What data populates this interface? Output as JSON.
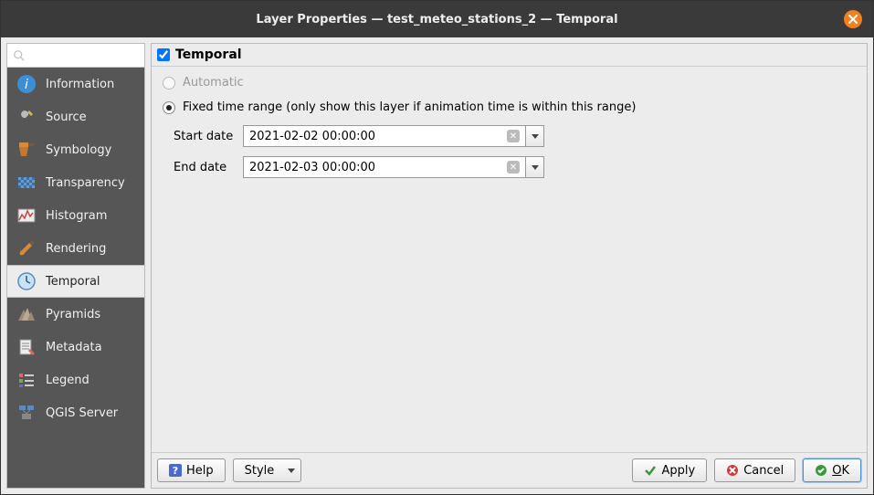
{
  "title": "Layer Properties — test_meteo_stations_2 — Temporal",
  "sidebar": {
    "items": [
      {
        "label": "Information"
      },
      {
        "label": "Source"
      },
      {
        "label": "Symbology"
      },
      {
        "label": "Transparency"
      },
      {
        "label": "Histogram"
      },
      {
        "label": "Rendering"
      },
      {
        "label": "Temporal"
      },
      {
        "label": "Pyramids"
      },
      {
        "label": "Metadata"
      },
      {
        "label": "Legend"
      },
      {
        "label": "QGIS Server"
      }
    ],
    "selected": "Temporal"
  },
  "section": {
    "checked": true,
    "title": "Temporal"
  },
  "options": {
    "automatic": {
      "label": "Automatic",
      "selected": false,
      "enabled": false
    },
    "fixed": {
      "label": "Fixed time range (only show this layer if animation time is within this range)",
      "selected": true
    }
  },
  "dates": {
    "start_label": "Start date",
    "start_value": "2021-02-02 00:00:00",
    "end_label": "End date",
    "end_value": "2021-02-03 00:00:00"
  },
  "footer": {
    "help": "Help",
    "style": "Style",
    "apply": "Apply",
    "cancel": "Cancel",
    "ok": "OK"
  }
}
